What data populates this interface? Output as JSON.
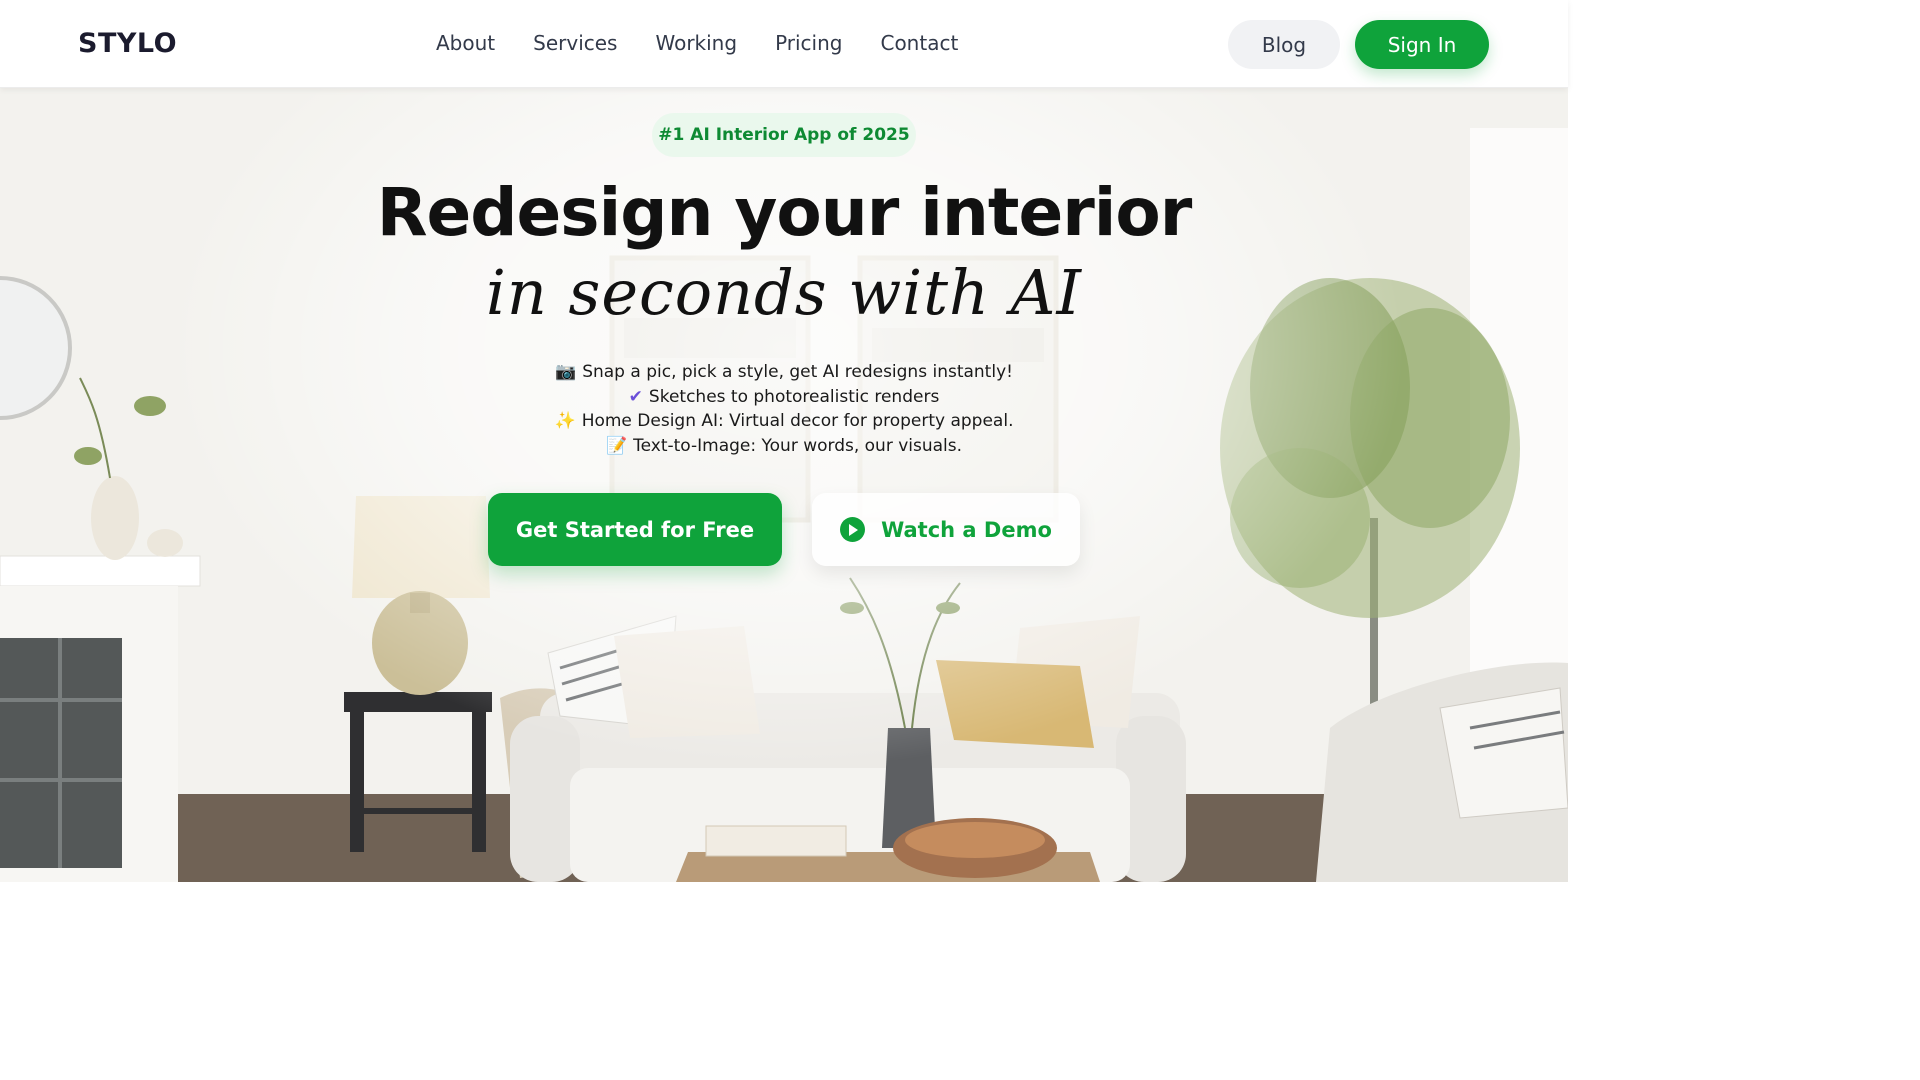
{
  "header": {
    "logo": "STYLO",
    "nav": [
      {
        "label": "About"
      },
      {
        "label": "Services"
      },
      {
        "label": "Working"
      },
      {
        "label": "Pricing"
      },
      {
        "label": "Contact"
      }
    ],
    "blog_label": "Blog",
    "signin_label": "Sign In"
  },
  "hero": {
    "badge": "#1 AI Interior App of 2025",
    "headline": "Redesign your interior",
    "headline_script": "in seconds with AI",
    "features": [
      {
        "icon": "📷",
        "icon_name": "camera-icon",
        "text": "Snap a pic, pick a style, get AI redesigns instantly!"
      },
      {
        "icon": "✔",
        "icon_name": "check-icon",
        "text": "Sketches to photorealistic renders"
      },
      {
        "icon": "✨",
        "icon_name": "sparkles-icon",
        "text": "Home Design AI: Virtual decor for property appeal."
      },
      {
        "icon": "📝",
        "icon_name": "memo-icon",
        "text": "Text-to-Image: Your words, our visuals."
      }
    ],
    "cta_primary": "Get Started for Free",
    "cta_secondary": "Watch a Demo"
  },
  "colors": {
    "brand_green": "#0fa33b",
    "badge_bg": "#e8f7ec",
    "text_dark": "#111111"
  }
}
